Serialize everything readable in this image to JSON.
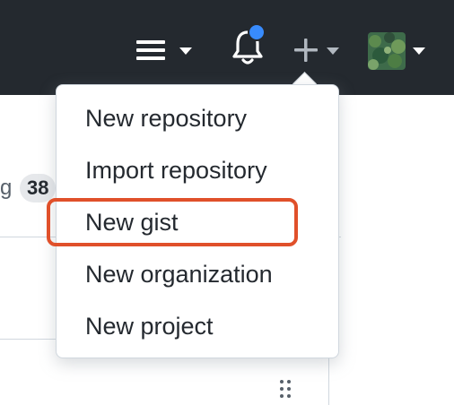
{
  "header": {
    "menu_icon": "hamburger-menu-icon",
    "notifications_icon": "bell-icon",
    "notification_dot_color": "#388bfd",
    "create_icon": "plus-icon",
    "avatar": "user-avatar"
  },
  "background": {
    "partial_text": "g",
    "counter": "38"
  },
  "create_menu": {
    "items": [
      {
        "label": "New repository"
      },
      {
        "label": "Import repository"
      },
      {
        "label": "New gist"
      },
      {
        "label": "New organization"
      },
      {
        "label": "New project"
      }
    ],
    "highlighted_item": "New gist",
    "highlight_color": "#e0502a"
  }
}
